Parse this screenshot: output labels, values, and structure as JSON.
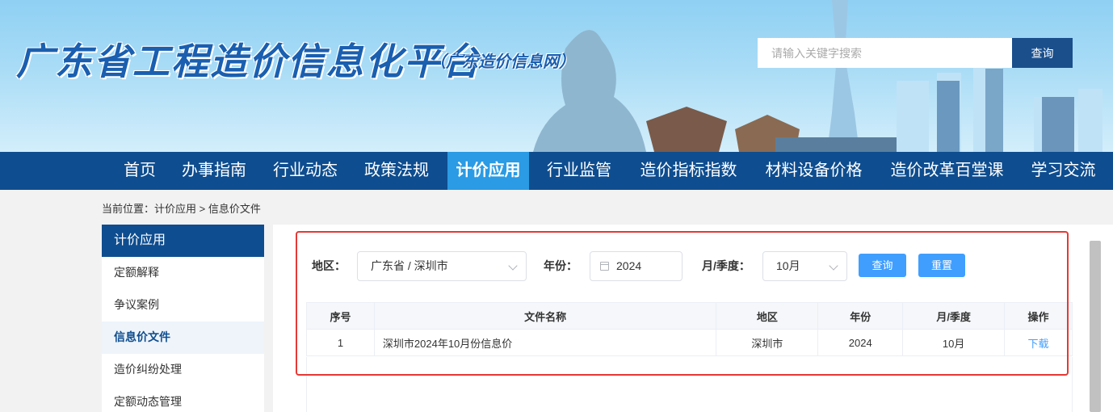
{
  "header": {
    "site_title": "广东省工程造价信息化平台",
    "site_subtitle": "（广东造价信息网）",
    "search_placeholder": "请输入关键字搜索",
    "search_button": "查询"
  },
  "nav": {
    "items": [
      {
        "label": "首页"
      },
      {
        "label": "办事指南"
      },
      {
        "label": "行业动态"
      },
      {
        "label": "政策法规"
      },
      {
        "label": "计价应用",
        "active": true
      },
      {
        "label": "行业监管"
      },
      {
        "label": "造价指标指数"
      },
      {
        "label": "材料设备价格"
      },
      {
        "label": "造价改革百堂课"
      },
      {
        "label": "学习交流"
      }
    ]
  },
  "breadcrumb": "当前位置：计价应用 > 信息价文件",
  "sidebar": {
    "title": "计价应用",
    "items": [
      {
        "label": "定额解释"
      },
      {
        "label": "争议案例"
      },
      {
        "label": "信息价文件",
        "active": true
      },
      {
        "label": "造价纠纷处理"
      },
      {
        "label": "定额动态管理"
      }
    ]
  },
  "filters": {
    "region_label": "地区：",
    "region_value": "广东省 / 深圳市",
    "year_label": "年份：",
    "year_value": "2024",
    "period_label": "月/季度：",
    "period_value": "10月",
    "query_button": "查询",
    "reset_button": "重置"
  },
  "table": {
    "headers": [
      "序号",
      "文件名称",
      "地区",
      "年份",
      "月/季度",
      "操作"
    ],
    "rows": [
      {
        "index": "1",
        "name": "深圳市2024年10月份信息价",
        "region": "深圳市",
        "year": "2024",
        "period": "10月",
        "action": "下载"
      }
    ]
  },
  "colors": {
    "nav_bg": "#0e4d8f",
    "nav_active": "#2a9be4",
    "button_blue": "#409eff",
    "highlight_red": "#e53935"
  }
}
